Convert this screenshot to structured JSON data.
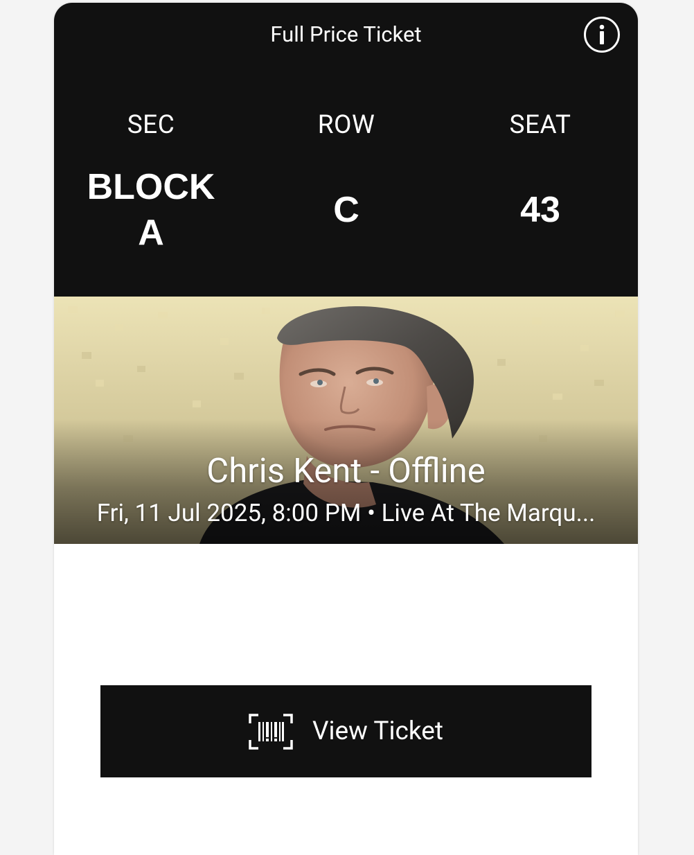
{
  "ticket": {
    "type_label": "Full Price Ticket",
    "info_icon": "info-icon",
    "seating": {
      "sec_label": "SEC",
      "row_label": "ROW",
      "seat_label": "SEAT",
      "sec_value": "BLOCK A",
      "row_value": "C",
      "seat_value": "43"
    }
  },
  "event": {
    "title": "Chris Kent - Offline",
    "meta": "Fri, 11 Jul 2025, 8:00 PM • Live At The Marqu..."
  },
  "actions": {
    "view_ticket_label": "View Ticket",
    "view_ticket_icon": "barcode-scan-icon"
  },
  "colors": {
    "header_bg": "#111111",
    "button_bg": "#111111",
    "text_on_dark": "#ffffff",
    "page_bg": "#f4f4f4",
    "card_bg": "#ffffff"
  }
}
